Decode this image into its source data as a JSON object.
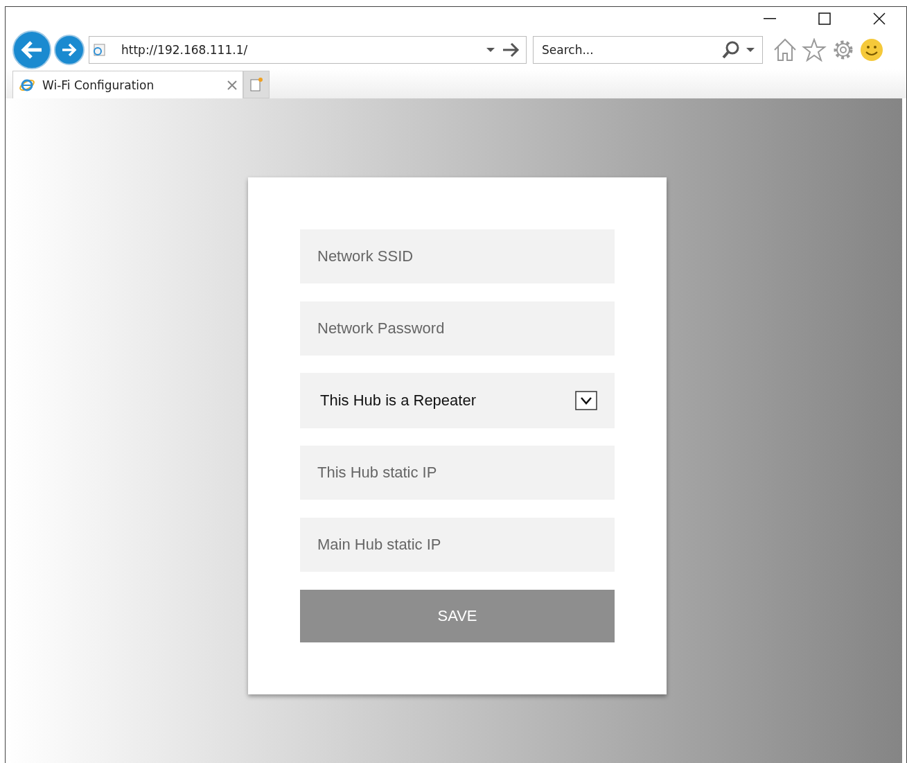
{
  "address_bar": {
    "value": "http://192.168.111.1/"
  },
  "search": {
    "placeholder": "Search..."
  },
  "tabs": [
    {
      "label": "Wi-Fi Configuration",
      "selected": true
    }
  ],
  "form": {
    "fields": [
      {
        "kind": "text",
        "placeholder": "Network SSID"
      },
      {
        "kind": "text",
        "placeholder": "Network Password"
      },
      {
        "kind": "select",
        "value": "This Hub is a Repeater"
      },
      {
        "kind": "text",
        "placeholder": "This Hub static IP"
      },
      {
        "kind": "text",
        "placeholder": "Main Hub static IP"
      }
    ],
    "button": "SAVE"
  }
}
